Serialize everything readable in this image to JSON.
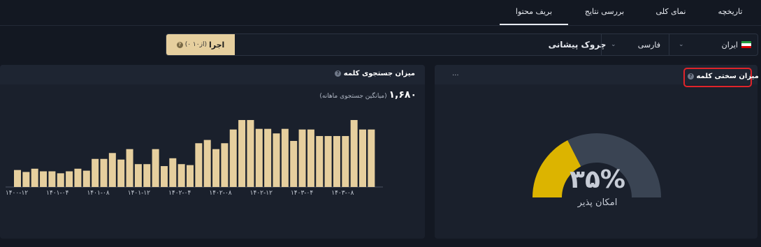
{
  "tabs": [
    {
      "label": "تاریخچه"
    },
    {
      "label": "نمای کلی"
    },
    {
      "label": "بررسی نتایج"
    },
    {
      "label": "بریف محتوا",
      "active": true
    }
  ],
  "toolbar": {
    "country": "ایران",
    "language": "فارسی",
    "keyword": "چروک پیشانی",
    "run_label": "اجرا",
    "run_quota": "(۰ از۱۰)",
    "run_help": "?"
  },
  "difficulty_card": {
    "title": "میزان سختی کلمه",
    "help": "?",
    "menu": "...",
    "value_text": "۳۵%",
    "value": 35,
    "label": "امکان پذیر",
    "colors": {
      "fill": "#dcb400",
      "track": "#3a4453"
    }
  },
  "volume_card": {
    "title": "میزان جستجوی کلمه",
    "help": "?",
    "total": "۱,۶۸۰",
    "total_label": "(میانگین جستجوی ماهانه)"
  },
  "chart_data": {
    "type": "bar",
    "color": "#e6cf9e",
    "x_tick_labels": [
      "۱۴۰۰-۱۲",
      "۱۴۰۱-۰۴",
      "۱۴۰۱-۰۸",
      "۱۴۰۱-۱۲",
      "۱۴۰۲-۰۴",
      "۱۴۰۲-۰۸",
      "۱۴۰۲-۱۲",
      "۱۴۰۳-۰۴",
      "۱۴۰۳-۰۸"
    ],
    "values": [
      520,
      460,
      560,
      480,
      480,
      420,
      480,
      560,
      500,
      860,
      860,
      1040,
      840,
      1160,
      700,
      700,
      1160,
      640,
      880,
      700,
      670,
      1340,
      1440,
      1160,
      1340,
      1760,
      2050,
      2050,
      1780,
      1780,
      1640,
      1780,
      1410,
      1760,
      1760,
      1560,
      1560,
      1560,
      1560,
      2050,
      1760,
      1760
    ],
    "ylim": [
      0,
      2200
    ]
  }
}
